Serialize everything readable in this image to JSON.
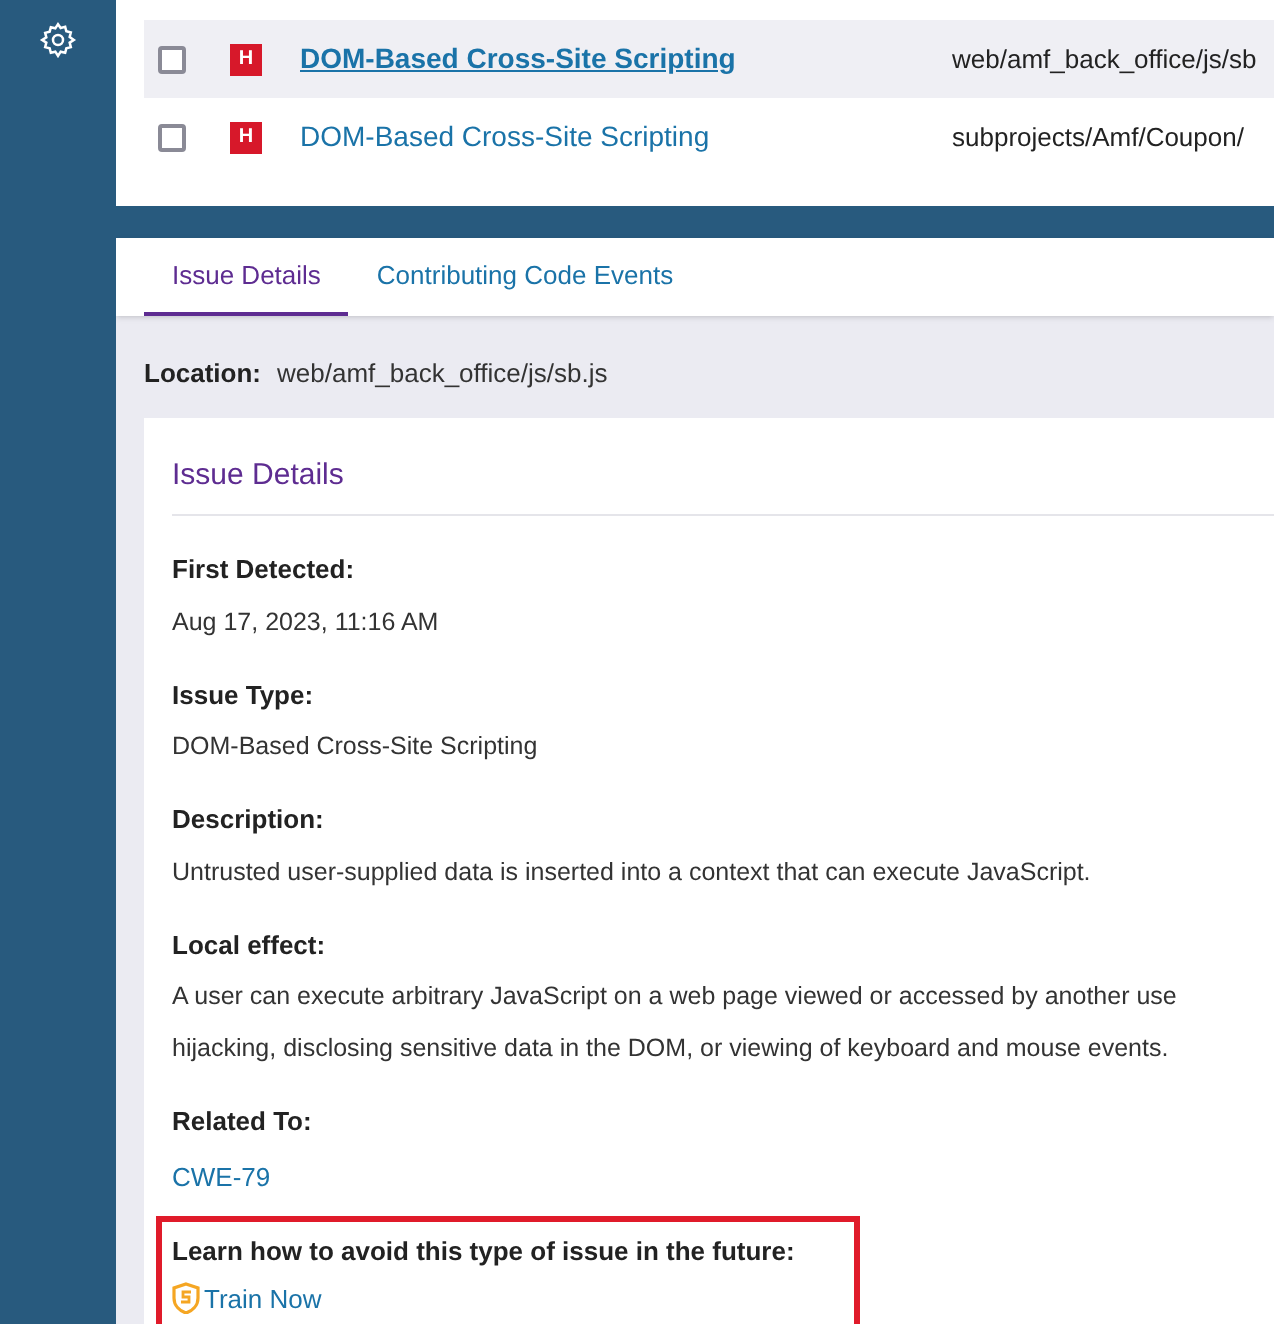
{
  "issues": [
    {
      "selected": true,
      "checked": false,
      "severity": "H",
      "title": "DOM-Based Cross-Site Scripting",
      "path": "web/amf_back_office/js/sb"
    },
    {
      "selected": false,
      "checked": false,
      "severity": "H",
      "title": "DOM-Based Cross-Site Scripting",
      "path": "subprojects/Amf/Coupon/"
    }
  ],
  "tabs": [
    {
      "label": "Issue Details",
      "selected": true
    },
    {
      "label": "Contributing Code Events",
      "selected": false
    }
  ],
  "location": {
    "label": "Location:",
    "value": "web/amf_back_office/js/sb.js"
  },
  "card": {
    "title": "Issue Details",
    "fields": [
      {
        "label": "First Detected:",
        "lines": [
          "Aug 17, 2023, 11:16 AM"
        ]
      },
      {
        "label": "Issue Type:",
        "lines": [
          "DOM-Based Cross-Site Scripting"
        ]
      },
      {
        "label": "Description:",
        "lines": [
          "Untrusted user-supplied data is inserted into a context that can execute JavaScript."
        ]
      },
      {
        "label": "Local effect:",
        "lines": [
          "A user can execute arbitrary JavaScript on a web page viewed or accessed by another use",
          "hijacking, disclosing sensitive data in the DOM, or viewing of keyboard and mouse events."
        ]
      },
      {
        "label": "Related To:",
        "link": "CWE-79"
      }
    ],
    "training": {
      "label": "Learn how to avoid this type of issue in the future:",
      "link": "Train Now"
    }
  }
}
